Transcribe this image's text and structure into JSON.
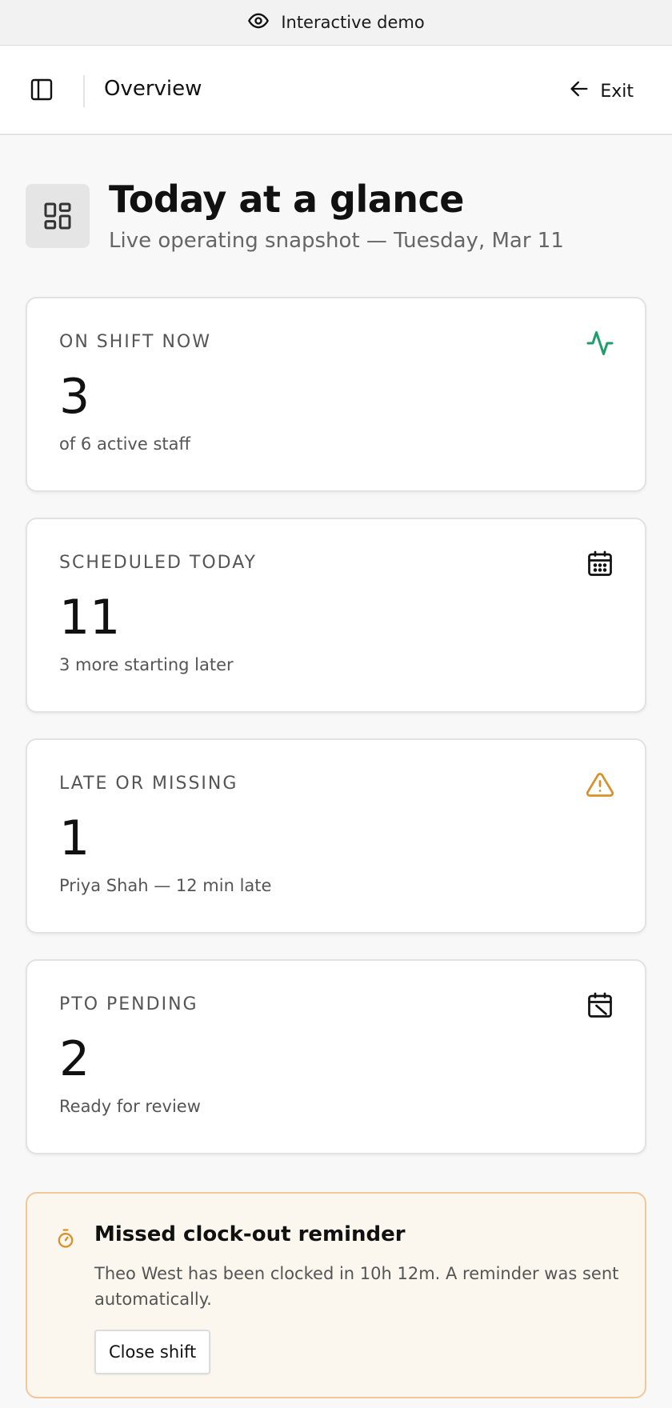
{
  "demo_bar": {
    "label": "Interactive demo",
    "icon": "eye-icon"
  },
  "topbar": {
    "title": "Overview",
    "exit_label": "Exit",
    "sidebar_icon": "sidebar-toggle-icon",
    "exit_icon": "arrow-left-icon"
  },
  "header": {
    "title": "Today at a glance",
    "subtitle": "Live operating snapshot — Tuesday, Mar 11",
    "icon": "dashboard-grid-icon"
  },
  "cards": [
    {
      "label": "ON SHIFT NOW",
      "value": "3",
      "note": "of 6 active staff",
      "icon": "activity-icon",
      "icon_color": "#1f9d6b"
    },
    {
      "label": "SCHEDULED TODAY",
      "value": "11",
      "note": "3 more starting later",
      "icon": "calendar-icon",
      "icon_color": "#111111"
    },
    {
      "label": "LATE OR MISSING",
      "value": "1",
      "note": "Priya Shah — 12 min late",
      "icon": "warning-icon",
      "icon_color": "#d9902a"
    },
    {
      "label": "PTO PENDING",
      "value": "2",
      "note": "Ready for review",
      "icon": "calendar-off-icon",
      "icon_color": "#111111"
    }
  ],
  "alert": {
    "title": "Missed clock-out reminder",
    "body": "Theo West has been clocked in 10h 12m. A reminder was sent automatically.",
    "button_label": "Close shift",
    "icon": "timer-icon",
    "accent_color": "#d9902a"
  }
}
